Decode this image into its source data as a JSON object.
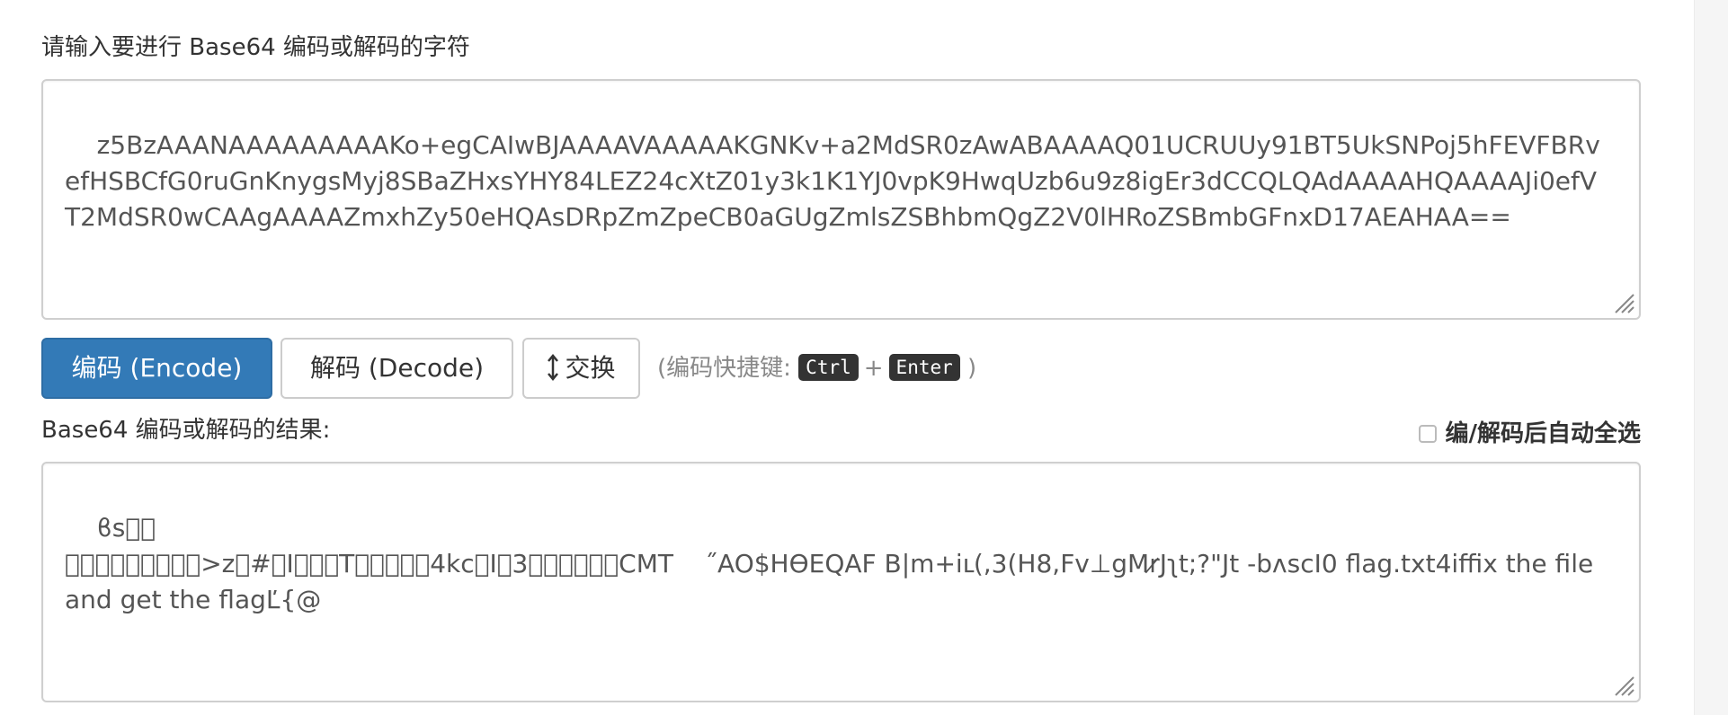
{
  "input_section": {
    "label": "请输入要进行 Base64 编码或解码的字符",
    "value": "z5BzAAANAAAAAAAAAKo+egCAIwBJAAAAVAAAAAKGNKv+a2MdSR0zAwABAAAAQ01UCRUUy91BT5UkSNPoj5hFEVFBRvefHSBCfG0ruGnKnygsMyj8SBaZHxsYHY84LEZ24cXtZ01y3k1K1YJ0vpK9HwqUzb6u9z8igEr3dCCQLQAdAAAAHQAAAAJi0efVT2MdSR0wCAAgAAAAZmxhZy50eHQAsDRpZmZpeCB0aGUgZmlsZSBhbmQgZ2V0lHRoZSBmbGFnxD17AEAHAA=="
  },
  "buttons": {
    "encode": "编码 (Encode)",
    "decode": "解码 (Decode)",
    "swap": "交换",
    "swap_icon": "up-down-arrow-icon"
  },
  "shortcut": {
    "prefix": "(编码快捷键:",
    "key1": "Ctrl",
    "plus": "+",
    "key2": "Enter",
    "suffix": ")"
  },
  "output_section": {
    "label": "Base64 编码或解码的结果:",
    "auto_select_label": "编/解码后自动全选",
    "auto_select_checked": false,
    "value": "ϐs\u0000\u0000\n\u0000\u0000\u0000\u0000\u0000\u0000\u0000\u0000\u0000>z\u0000#\u0000I\u0000\u0000\u0000T\u0000\u0000\u0000\u0000\u00024kc\u001dI\u001d3\u0003\u0000\u0001\u0000\u0000\u0000CMT\t\u0015\u0014˝AO$HӨE\u0011QAF\u001d B|m+iւ(,3(H\u0016\u001f\u0018\u0018\u001d8,Fv⊥gMr̷Jʅt\u001f;?\"Jt -\u0000\u001d\u0000\u0000\u0000\u001d\u0000\u0000\u0000\u0002bʌsc\u001dI\u001d0\b\u0000 \u0000\u0000\u0000flag.txt\u00004iffix the file and get the flagĽ{\u0000@\u0007\u0000"
  },
  "colors": {
    "primary": "#337ab7",
    "kbd_bg": "#333333"
  }
}
